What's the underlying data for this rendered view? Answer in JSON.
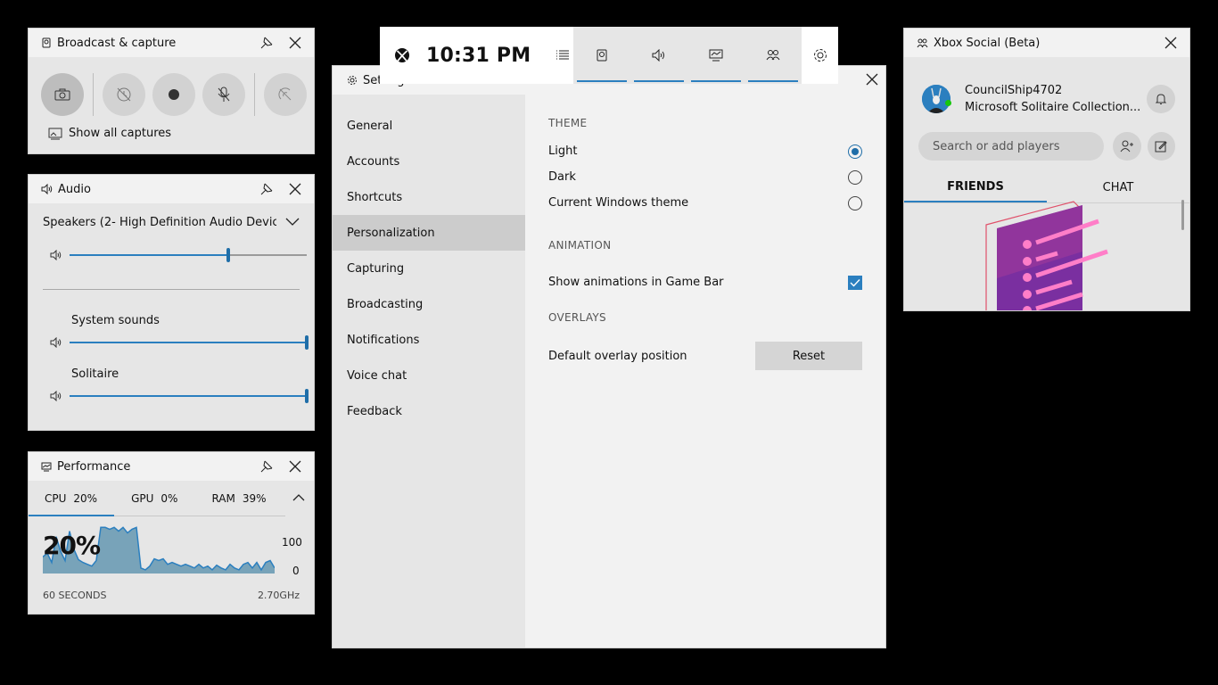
{
  "broadcast": {
    "title": "Broadcast & capture",
    "show_all_label": "Show all captures"
  },
  "audio": {
    "title": "Audio",
    "device": "Speakers (2- High Definition Audio Devic...",
    "master_level": 0.67,
    "apps": [
      {
        "name": "System sounds",
        "level": 1.0
      },
      {
        "name": "Solitaire",
        "level": 1.0
      }
    ]
  },
  "performance": {
    "title": "Performance",
    "tabs": [
      {
        "label": "CPU",
        "value": "20%"
      },
      {
        "label": "GPU",
        "value": "0%"
      },
      {
        "label": "RAM",
        "value": "39%"
      }
    ],
    "big_value": "20%",
    "axis_max": "100",
    "axis_min": "0",
    "duration": "60 SECONDS",
    "frequency": "2.70GHz",
    "history": [
      18,
      22,
      12,
      40,
      24,
      14,
      46,
      26,
      15,
      12,
      10,
      8,
      14,
      50,
      50,
      48,
      50,
      46,
      50,
      44,
      48,
      50,
      6,
      4,
      8,
      16,
      14,
      16,
      10,
      12,
      10,
      8,
      10,
      8,
      6,
      10,
      6,
      8,
      4,
      9,
      6,
      4,
      10,
      6,
      4,
      10,
      12,
      6,
      12,
      4,
      12,
      14,
      6
    ]
  },
  "gamebar": {
    "time": "10:31 PM"
  },
  "settings": {
    "title": "Settings",
    "nav": [
      "General",
      "Accounts",
      "Shortcuts",
      "Personalization",
      "Capturing",
      "Broadcasting",
      "Notifications",
      "Voice chat",
      "Feedback"
    ],
    "selected_nav": "Personalization",
    "theme_section": "THEME",
    "theme_options": [
      {
        "label": "Light",
        "selected": true
      },
      {
        "label": "Dark",
        "selected": false
      },
      {
        "label": "Current Windows theme",
        "selected": false
      }
    ],
    "animation_section": "ANIMATION",
    "animation_label": "Show animations in Game Bar",
    "animation_checked": true,
    "overlays_section": "OVERLAYS",
    "overlay_label": "Default overlay position",
    "reset_label": "Reset"
  },
  "social": {
    "title": "Xbox Social (Beta)",
    "gamertag": "CouncilShip4702",
    "status": "Microsoft Solitaire Collection...",
    "search_placeholder": "Search or add players",
    "tabs": [
      "FRIENDS",
      "CHAT"
    ],
    "active_tab": "FRIENDS"
  },
  "colors": {
    "accent": "#2b7fbf",
    "panel": "#e6e6e6",
    "online": "#16c60c"
  }
}
